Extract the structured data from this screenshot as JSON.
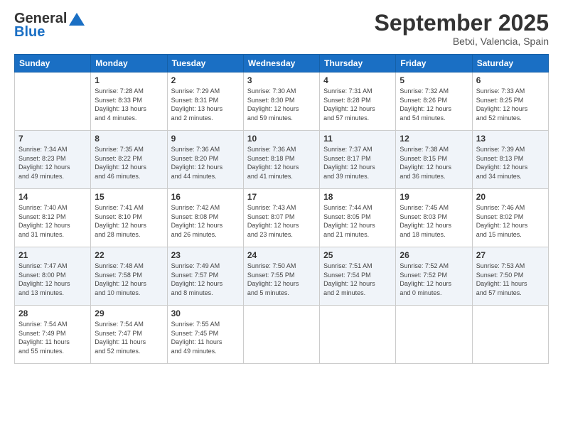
{
  "header": {
    "logo_general": "General",
    "logo_blue": "Blue",
    "month_title": "September 2025",
    "location": "Betxi, Valencia, Spain"
  },
  "days_of_week": [
    "Sunday",
    "Monday",
    "Tuesday",
    "Wednesday",
    "Thursday",
    "Friday",
    "Saturday"
  ],
  "weeks": [
    [
      {
        "day": "",
        "info": ""
      },
      {
        "day": "1",
        "info": "Sunrise: 7:28 AM\nSunset: 8:33 PM\nDaylight: 13 hours\nand 4 minutes."
      },
      {
        "day": "2",
        "info": "Sunrise: 7:29 AM\nSunset: 8:31 PM\nDaylight: 13 hours\nand 2 minutes."
      },
      {
        "day": "3",
        "info": "Sunrise: 7:30 AM\nSunset: 8:30 PM\nDaylight: 12 hours\nand 59 minutes."
      },
      {
        "day": "4",
        "info": "Sunrise: 7:31 AM\nSunset: 8:28 PM\nDaylight: 12 hours\nand 57 minutes."
      },
      {
        "day": "5",
        "info": "Sunrise: 7:32 AM\nSunset: 8:26 PM\nDaylight: 12 hours\nand 54 minutes."
      },
      {
        "day": "6",
        "info": "Sunrise: 7:33 AM\nSunset: 8:25 PM\nDaylight: 12 hours\nand 52 minutes."
      }
    ],
    [
      {
        "day": "7",
        "info": "Sunrise: 7:34 AM\nSunset: 8:23 PM\nDaylight: 12 hours\nand 49 minutes."
      },
      {
        "day": "8",
        "info": "Sunrise: 7:35 AM\nSunset: 8:22 PM\nDaylight: 12 hours\nand 46 minutes."
      },
      {
        "day": "9",
        "info": "Sunrise: 7:36 AM\nSunset: 8:20 PM\nDaylight: 12 hours\nand 44 minutes."
      },
      {
        "day": "10",
        "info": "Sunrise: 7:36 AM\nSunset: 8:18 PM\nDaylight: 12 hours\nand 41 minutes."
      },
      {
        "day": "11",
        "info": "Sunrise: 7:37 AM\nSunset: 8:17 PM\nDaylight: 12 hours\nand 39 minutes."
      },
      {
        "day": "12",
        "info": "Sunrise: 7:38 AM\nSunset: 8:15 PM\nDaylight: 12 hours\nand 36 minutes."
      },
      {
        "day": "13",
        "info": "Sunrise: 7:39 AM\nSunset: 8:13 PM\nDaylight: 12 hours\nand 34 minutes."
      }
    ],
    [
      {
        "day": "14",
        "info": "Sunrise: 7:40 AM\nSunset: 8:12 PM\nDaylight: 12 hours\nand 31 minutes."
      },
      {
        "day": "15",
        "info": "Sunrise: 7:41 AM\nSunset: 8:10 PM\nDaylight: 12 hours\nand 28 minutes."
      },
      {
        "day": "16",
        "info": "Sunrise: 7:42 AM\nSunset: 8:08 PM\nDaylight: 12 hours\nand 26 minutes."
      },
      {
        "day": "17",
        "info": "Sunrise: 7:43 AM\nSunset: 8:07 PM\nDaylight: 12 hours\nand 23 minutes."
      },
      {
        "day": "18",
        "info": "Sunrise: 7:44 AM\nSunset: 8:05 PM\nDaylight: 12 hours\nand 21 minutes."
      },
      {
        "day": "19",
        "info": "Sunrise: 7:45 AM\nSunset: 8:03 PM\nDaylight: 12 hours\nand 18 minutes."
      },
      {
        "day": "20",
        "info": "Sunrise: 7:46 AM\nSunset: 8:02 PM\nDaylight: 12 hours\nand 15 minutes."
      }
    ],
    [
      {
        "day": "21",
        "info": "Sunrise: 7:47 AM\nSunset: 8:00 PM\nDaylight: 12 hours\nand 13 minutes."
      },
      {
        "day": "22",
        "info": "Sunrise: 7:48 AM\nSunset: 7:58 PM\nDaylight: 12 hours\nand 10 minutes."
      },
      {
        "day": "23",
        "info": "Sunrise: 7:49 AM\nSunset: 7:57 PM\nDaylight: 12 hours\nand 8 minutes."
      },
      {
        "day": "24",
        "info": "Sunrise: 7:50 AM\nSunset: 7:55 PM\nDaylight: 12 hours\nand 5 minutes."
      },
      {
        "day": "25",
        "info": "Sunrise: 7:51 AM\nSunset: 7:54 PM\nDaylight: 12 hours\nand 2 minutes."
      },
      {
        "day": "26",
        "info": "Sunrise: 7:52 AM\nSunset: 7:52 PM\nDaylight: 12 hours\nand 0 minutes."
      },
      {
        "day": "27",
        "info": "Sunrise: 7:53 AM\nSunset: 7:50 PM\nDaylight: 11 hours\nand 57 minutes."
      }
    ],
    [
      {
        "day": "28",
        "info": "Sunrise: 7:54 AM\nSunset: 7:49 PM\nDaylight: 11 hours\nand 55 minutes."
      },
      {
        "day": "29",
        "info": "Sunrise: 7:54 AM\nSunset: 7:47 PM\nDaylight: 11 hours\nand 52 minutes."
      },
      {
        "day": "30",
        "info": "Sunrise: 7:55 AM\nSunset: 7:45 PM\nDaylight: 11 hours\nand 49 minutes."
      },
      {
        "day": "",
        "info": ""
      },
      {
        "day": "",
        "info": ""
      },
      {
        "day": "",
        "info": ""
      },
      {
        "day": "",
        "info": ""
      }
    ]
  ]
}
